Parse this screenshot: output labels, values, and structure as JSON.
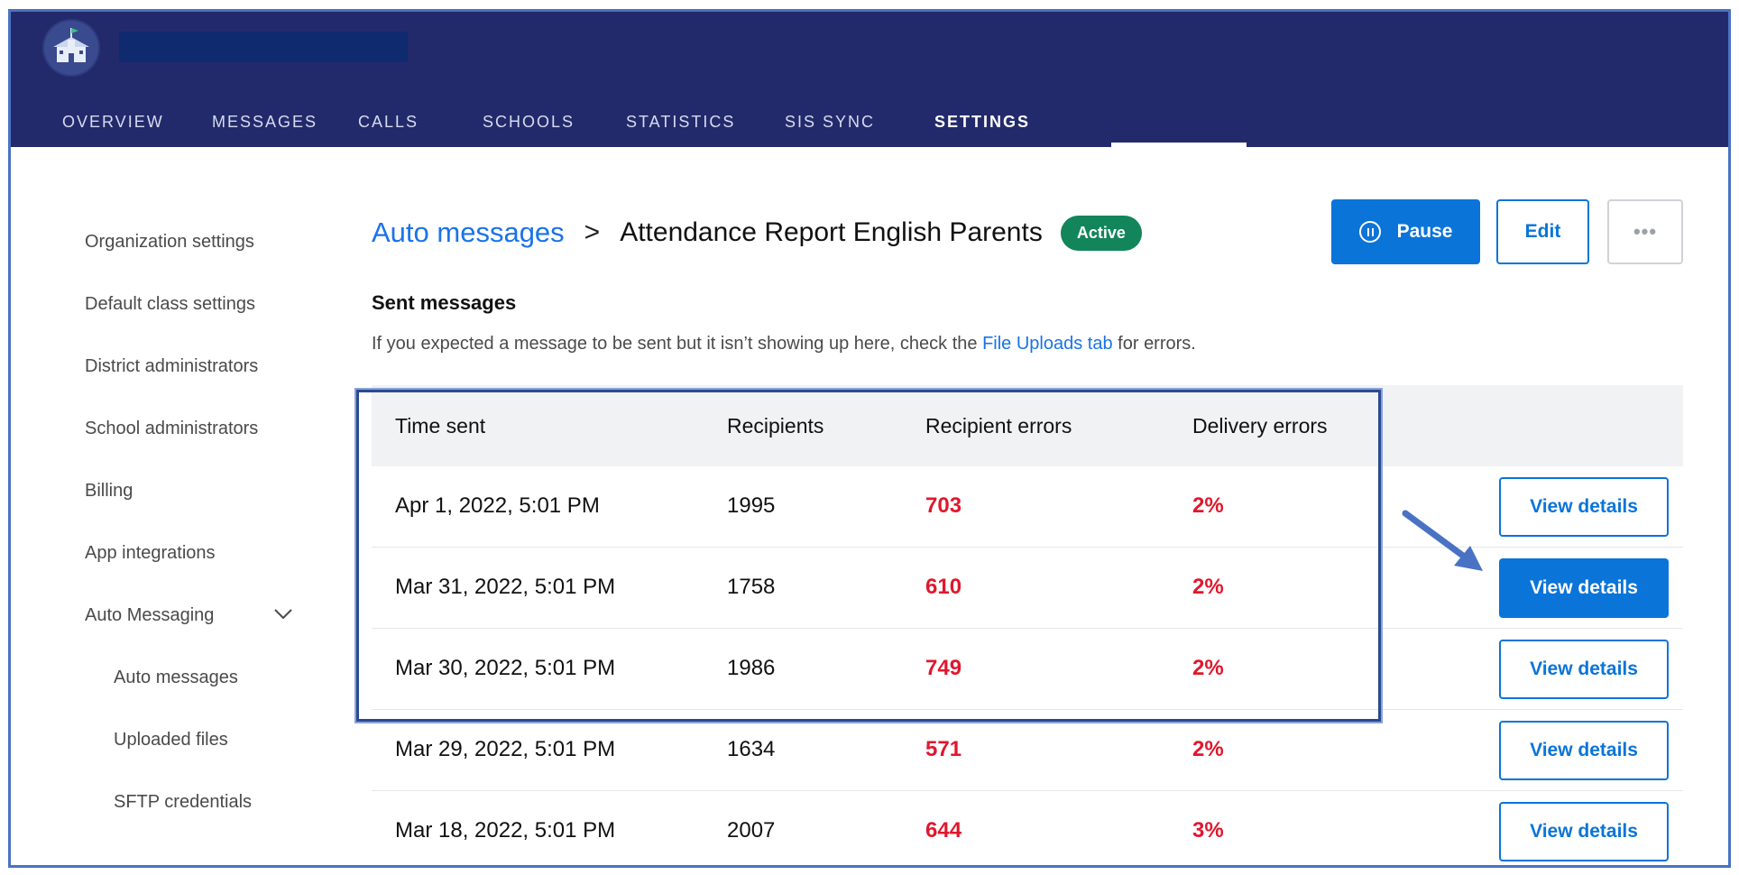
{
  "nav": {
    "items": [
      "OVERVIEW",
      "MESSAGES",
      "CALLS",
      "SCHOOLS",
      "STATISTICS",
      "SIS SYNC",
      "SETTINGS"
    ],
    "active": "SETTINGS"
  },
  "sidebar": {
    "items": [
      "Organization settings",
      "Default class settings",
      "District administrators",
      "School administrators",
      "Billing",
      "App integrations",
      "Auto Messaging",
      "Auto messages",
      "Uploaded files",
      "SFTP credentials"
    ]
  },
  "header": {
    "breadcrumb_link": "Auto messages",
    "separator": ">",
    "title": "Attendance Report English Parents",
    "status": "Active",
    "pause_label": "Pause",
    "edit_label": "Edit",
    "more_label": "•••"
  },
  "section": {
    "title": "Sent messages",
    "note_prefix": "If you expected a message to be sent but it isn’t showing up here, check the ",
    "note_link": "File Uploads tab",
    "note_suffix": " for errors."
  },
  "table": {
    "headers": [
      "Time sent",
      "Recipients",
      "Recipient errors",
      "Delivery errors"
    ],
    "rows": [
      {
        "time": "Apr 1, 2022, 5:01 PM",
        "recipients": "1995",
        "recipient_errors": "703",
        "delivery_errors": "2%",
        "action": "View details"
      },
      {
        "time": "Mar 31, 2022, 5:01 PM",
        "recipients": "1758",
        "recipient_errors": "610",
        "delivery_errors": "2%",
        "action": "View details"
      },
      {
        "time": "Mar 30, 2022, 5:01 PM",
        "recipients": "1986",
        "recipient_errors": "749",
        "delivery_errors": "2%",
        "action": "View details"
      },
      {
        "time": "Mar 29, 2022, 5:01 PM",
        "recipients": "1634",
        "recipient_errors": "571",
        "delivery_errors": "2%",
        "action": "View details"
      },
      {
        "time": "Mar 18, 2022, 5:01 PM",
        "recipients": "2007",
        "recipient_errors": "644",
        "delivery_errors": "3%",
        "action": "View details"
      }
    ]
  },
  "colors": {
    "topbar": "#232a6b",
    "accent": "#0a74d9",
    "active_badge": "#12855a",
    "error": "#e0182d",
    "annotation": "#4a72c4"
  },
  "icons": [
    "school-logo-icon",
    "chevron-down-icon",
    "pause-icon",
    "more-icon",
    "annotation-arrow-icon"
  ]
}
